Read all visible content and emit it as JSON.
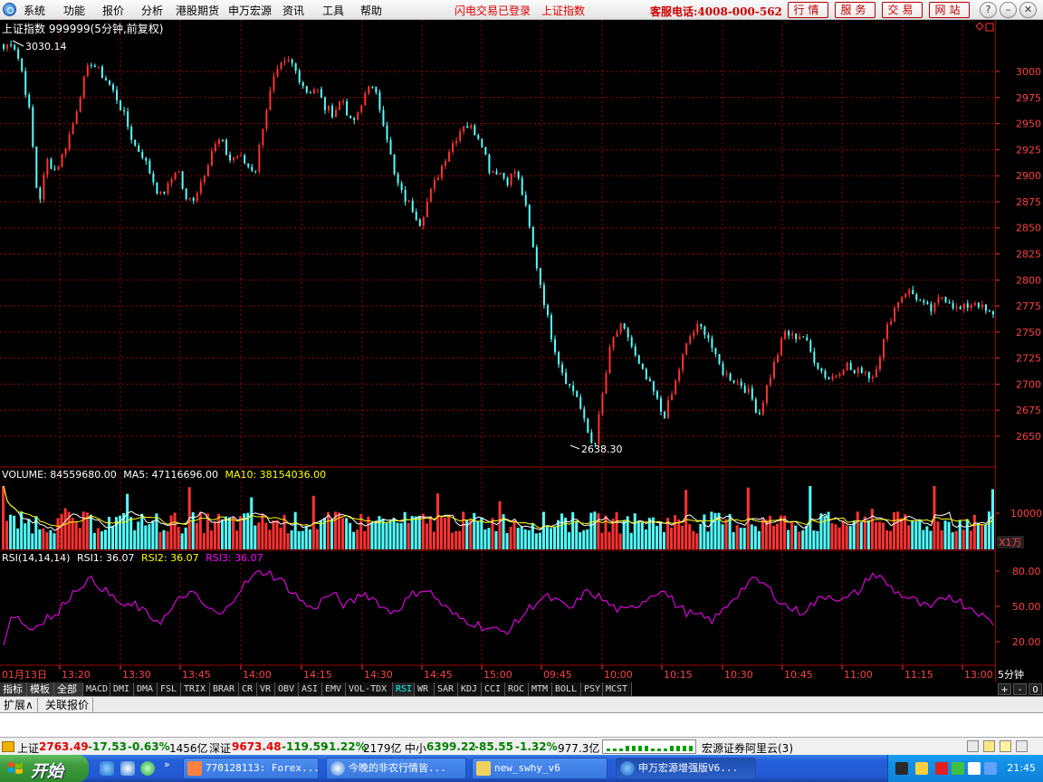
{
  "menu": {
    "items": [
      "系统",
      "功能",
      "报价",
      "分析",
      "港股期货",
      "申万宏源",
      "资讯",
      "工具",
      "帮助"
    ],
    "flash_login": "闪电交易已登录",
    "index_name": "上证指数",
    "hotline": "客服电话:4008-000-562",
    "buttons": [
      "行情",
      "服务",
      "交易",
      "网站"
    ]
  },
  "chart": {
    "title": "上证指数 999999(5分钟,前复权)",
    "high_label": "3030.14",
    "low_label": "2638.30",
    "price_ticks": [
      "3000",
      "2975",
      "2950",
      "2925",
      "2900",
      "2875",
      "2850",
      "2825",
      "2800",
      "2775",
      "2750",
      "2725",
      "2700",
      "2675",
      "2650"
    ],
    "volume_header": {
      "volume": "VOLUME: 84559680.00",
      "ma5": "MA5: 47116696.00",
      "ma10": "MA10: 38154036.00"
    },
    "volume_tick": "10000",
    "volume_unit": "X1万",
    "rsi_header": {
      "name": "RSI(14,14,14)",
      "rsi1": "RSI1: 36.07",
      "rsi2": "RSI2: 36.07",
      "rsi3": "RSI3: 36.07"
    },
    "rsi_ticks": [
      "80.00",
      "50.00",
      "20.00"
    ],
    "time_labels": [
      "01月13日",
      "13:20",
      "13:30",
      "13:45",
      "14:00",
      "14:15",
      "14:30",
      "14:45",
      "15:00",
      "09:45",
      "10:00",
      "10:15",
      "10:30",
      "10:45",
      "11:00",
      "11:15",
      "13:00"
    ],
    "period": "5分钟",
    "colors": {
      "up": "#ff3232",
      "down": "#54ffff",
      "grid": "#a00000",
      "ma5": "#ffffff",
      "ma10": "#ffff00",
      "rsi": "#ff00ff"
    }
  },
  "chart_data": [
    {
      "type": "candlestick",
      "title": "上证指数 999999(5分钟,前复权)",
      "ylim": [
        2630,
        3035
      ],
      "y_ticks": [
        2650,
        2675,
        2700,
        2725,
        2750,
        2775,
        2800,
        2825,
        2850,
        2875,
        2900,
        2925,
        2950,
        2975,
        3000
      ],
      "annotations": [
        {
          "label": "3030.14",
          "value": 3030.14
        },
        {
          "label": "2638.30",
          "value": 2638.3
        }
      ],
      "close_path": [
        3022,
        3030.14,
        3005,
        2960,
        2870,
        2915,
        2905,
        2925,
        2950,
        2985,
        3010,
        3000,
        2990,
        2975,
        2955,
        2930,
        2920,
        2900,
        2880,
        2890,
        2910,
        2875,
        2880,
        2900,
        2925,
        2935,
        2915,
        2920,
        2910,
        2905,
        2955,
        2990,
        3005,
        3010,
        2995,
        2980,
        2985,
        2965,
        2960,
        2975,
        2950,
        2960,
        2990,
        2975,
        2945,
        2900,
        2880,
        2870,
        2855,
        2880,
        2900,
        2920,
        2935,
        2950,
        2945,
        2935,
        2905,
        2905,
        2895,
        2905,
        2875,
        2830,
        2790,
        2750,
        2720,
        2700,
        2690,
        2660,
        2638.3,
        2690,
        2740,
        2755,
        2745,
        2720,
        2705,
        2690,
        2668,
        2690,
        2720,
        2745,
        2755,
        2750,
        2725,
        2710,
        2705,
        2700,
        2690,
        2670,
        2700,
        2725,
        2750,
        2745,
        2748,
        2730,
        2715,
        2705,
        2710,
        2720,
        2710,
        2715,
        2705,
        2730,
        2760,
        2780,
        2790,
        2785,
        2775,
        2770,
        2785,
        2780,
        2770,
        2775,
        2780,
        2770,
        2765
      ],
      "segments_after": [
        "15:00",
        "09:45"
      ]
    },
    {
      "type": "bar",
      "title": "VOLUME",
      "series": [
        {
          "name": "VOLUME",
          "last": 84559680.0
        },
        {
          "name": "MA5",
          "last": 47116696.0
        },
        {
          "name": "MA10",
          "last": 38154036.0
        }
      ],
      "unit": "X1万",
      "y_ticks": [
        10000
      ]
    },
    {
      "type": "line",
      "title": "RSI(14,14,14)",
      "series": [
        {
          "name": "RSI1",
          "last": 36.07
        },
        {
          "name": "RSI2",
          "last": 36.07
        },
        {
          "name": "RSI3",
          "last": 36.07
        }
      ],
      "ylim": [
        0,
        100
      ],
      "y_ticks": [
        20,
        50,
        80
      ],
      "rsi_path": [
        20,
        45,
        38,
        30,
        35,
        42,
        40,
        55,
        62,
        70,
        72,
        68,
        60,
        55,
        48,
        52,
        45,
        40,
        38,
        45,
        55,
        62,
        58,
        50,
        45,
        42,
        55,
        65,
        72,
        78,
        80,
        75,
        70,
        62,
        55,
        48,
        52,
        60,
        58,
        50,
        55,
        62,
        58,
        52,
        45,
        48,
        55,
        62,
        65,
        60,
        52,
        45,
        40,
        38,
        35,
        32,
        30,
        28,
        32,
        40,
        48,
        55,
        58,
        55,
        50,
        48,
        60,
        62,
        58,
        52,
        48,
        45,
        50,
        55,
        60,
        65,
        58,
        50,
        45,
        42,
        40,
        38,
        45,
        55,
        62,
        70,
        72,
        68,
        60,
        52,
        48,
        45,
        50,
        55,
        60,
        58,
        55,
        60,
        65,
        78,
        75,
        68,
        62,
        58,
        55,
        50,
        48,
        55,
        60,
        55,
        50,
        48,
        40,
        36
      ]
    }
  ],
  "indicator_tabs": [
    "指标",
    "模板",
    "全部",
    "MACD",
    "DMI",
    "DMA",
    "FSL",
    "TRIX",
    "BRAR",
    "CR",
    "VR",
    "OBV",
    "ASI",
    "EMV",
    "VOL-TDX",
    "RSI",
    "WR",
    "SAR",
    "KDJ",
    "CCI",
    "ROC",
    "MTM",
    "BOLL",
    "PSY",
    "MCST"
  ],
  "active_tab": "RSI",
  "panel_controls": [
    "+",
    "-",
    "0"
  ],
  "ext_tabs": [
    "扩展∧",
    "关联报价"
  ],
  "status": {
    "sh_label": "上证",
    "sh_value": "2763.49",
    "sh_change": "-17.53",
    "sh_pct": "-0.63%",
    "sh_amount": "1456亿",
    "sz_label": "深证",
    "sz_value": "9673.48",
    "sz_change": "-119.59",
    "sz_pct": "-1.22%",
    "sz_amount": "2179亿",
    "zx_label": "中小",
    "zx_value": "6399.22",
    "zx_change": "-85.55",
    "zx_pct": "-1.32%",
    "zx_amount": "977.3亿",
    "server": "宏源证券阿里云(3)"
  },
  "taskbar": {
    "start": "开始",
    "tasks": [
      "770128113: Forex...",
      "今晚的非农行情皆...",
      "new_swhy_v6",
      "申万宏源增强版V6..."
    ],
    "clock": "21:45"
  }
}
